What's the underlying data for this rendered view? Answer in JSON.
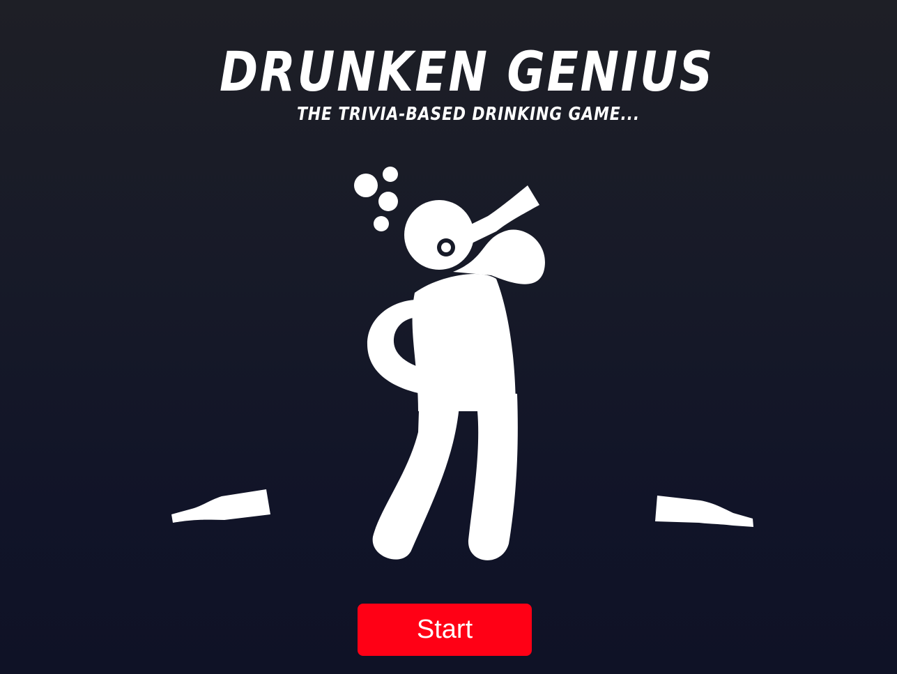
{
  "game": {
    "title": "DRUNKEN GENIUS",
    "subtitle": "THE TRIVIA-BASED DRINKING GAME...",
    "start_label": "Start"
  },
  "colors": {
    "background_top": "#1e1f26",
    "background_bottom": "#0f1226",
    "foreground": "#ffffff",
    "accent": "#ff0015"
  },
  "icons": {
    "hero": "drinking-stick-figure-icon",
    "left_bottle": "bottle-icon",
    "right_bottle": "bottle-icon"
  }
}
